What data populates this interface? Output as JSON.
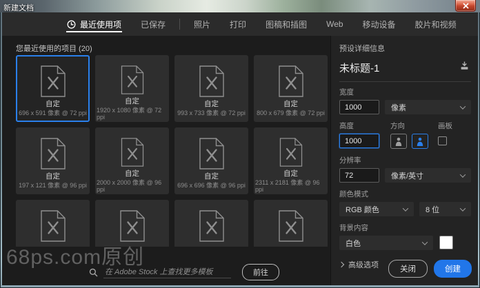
{
  "window": {
    "title": "新建文档"
  },
  "tabs": [
    {
      "label": "最近使用项",
      "active": true,
      "icon": "clock",
      "divider_after": false
    },
    {
      "label": "已保存",
      "active": false,
      "divider_after": true
    },
    {
      "label": "照片",
      "active": false,
      "divider_after": false
    },
    {
      "label": "打印",
      "active": false,
      "divider_after": false
    },
    {
      "label": "图稿和插图",
      "active": false,
      "divider_after": false
    },
    {
      "label": "Web",
      "active": false,
      "divider_after": false
    },
    {
      "label": "移动设备",
      "active": false,
      "divider_after": false
    },
    {
      "label": "胶片和视频",
      "active": false,
      "divider_after": false
    }
  ],
  "recent": {
    "header": "您最近使用的项目 (20)",
    "items": [
      {
        "title": "自定",
        "spec": "696 x 591 像素 @ 72 ppi",
        "selected": true
      },
      {
        "title": "自定",
        "spec": "1920 x 1080 像素 @ 72 ppi",
        "selected": false
      },
      {
        "title": "自定",
        "spec": "993 x 733 像素 @ 72 ppi",
        "selected": false
      },
      {
        "title": "自定",
        "spec": "800 x 679 像素 @ 72 ppi",
        "selected": false
      },
      {
        "title": "自定",
        "spec": "197 x 121 像素 @ 96 ppi",
        "selected": false
      },
      {
        "title": "自定",
        "spec": "2000 x 2000 像素 @ 96 ppi",
        "selected": false
      },
      {
        "title": "自定",
        "spec": "696 x 696 像素 @ 96 ppi",
        "selected": false
      },
      {
        "title": "自定",
        "spec": "2311 x 2181 像素 @ 96 ppi",
        "selected": false
      },
      {
        "title": null,
        "spec": null,
        "selected": false
      },
      {
        "title": null,
        "spec": null,
        "selected": false
      },
      {
        "title": null,
        "spec": null,
        "selected": false
      },
      {
        "title": null,
        "spec": null,
        "selected": false
      }
    ]
  },
  "search": {
    "placeholder": "在 Adobe Stock 上查找更多模板",
    "go_label": "前往"
  },
  "preset": {
    "header": "预设详细信息",
    "doc_name": "未标题-1",
    "width_label": "宽度",
    "width_value": "1000",
    "width_unit": "像素",
    "height_label": "高度",
    "height_value": "1000",
    "orientation_label": "方向",
    "artboard_label": "画板",
    "resolution_label": "分辨率",
    "resolution_value": "72",
    "resolution_unit": "像素/英寸",
    "color_mode_label": "颜色模式",
    "color_mode_value": "RGB 颜色",
    "bit_depth_value": "8 位",
    "background_label": "背景内容",
    "background_value": "白色",
    "advanced_label": "高级选项"
  },
  "footer": {
    "close_label": "关闭",
    "create_label": "创建"
  },
  "watermark": "68ps.com原创",
  "colors": {
    "accent": "#2a80eb",
    "create_button": "#2176e9",
    "background_swatch": "#ffffff"
  }
}
